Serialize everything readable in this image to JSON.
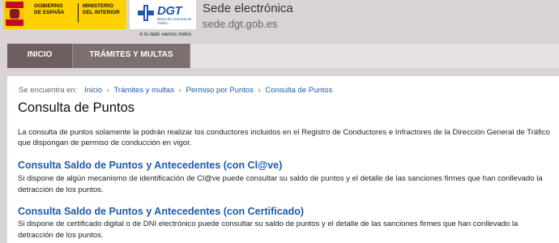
{
  "header": {
    "gov_logo": {
      "ministry_left": "GOBIERNO DE ESPAÑA",
      "ministry_right": "MINISTERIO DEL INTERIOR"
    },
    "dgt_logo": {
      "wordmark": "DGT",
      "subtitle": "Dirección General de Tráfico",
      "tagline": "A tu lado vamos todos"
    },
    "site_title": "Sede electrónica",
    "site_url": "sede.dgt.gob.es"
  },
  "nav": {
    "items": [
      {
        "label": "INICIO"
      },
      {
        "label": "TRÁMITES Y MULTAS"
      }
    ]
  },
  "breadcrumb": {
    "prefix": "Se encuentra en:",
    "items": [
      "Inicio",
      "Trámites y multas",
      "Permiso por Puntos",
      "Consulta de Puntos"
    ],
    "separator": "›"
  },
  "main": {
    "title": "Consulta de Puntos",
    "intro": "La consulta de puntos solamente la podrán realizar los conductores incluidos en el Registro de Conductores e Infractores de la Dirección General de Tráfico que dispongan de permiso de conducción en vigor.",
    "sections": [
      {
        "title": "Consulta Saldo de Puntos y Antecedentes (con Cl@ve)",
        "text": "Si dispone de algún mecanismo de identificación de Cl@ve puede consultar su saldo de puntos y el detalle de las sanciones firmes que han conllevado la detracción de los puntos."
      },
      {
        "title": "Consulta Saldo de Puntos y Antecedentes (con Certificado)",
        "text": "Si dispone de certificado digital o de DNI electrónico puede consultar su saldo de puntos y el detalle de las sanciones firmes que han conllevado la detracción de los puntos."
      }
    ]
  },
  "colors": {
    "link_blue": "#1f5aa8",
    "nav_bg": "#7c6f6f",
    "page_bg": "#dad3d5",
    "gov_yellow": "#ffd100"
  }
}
